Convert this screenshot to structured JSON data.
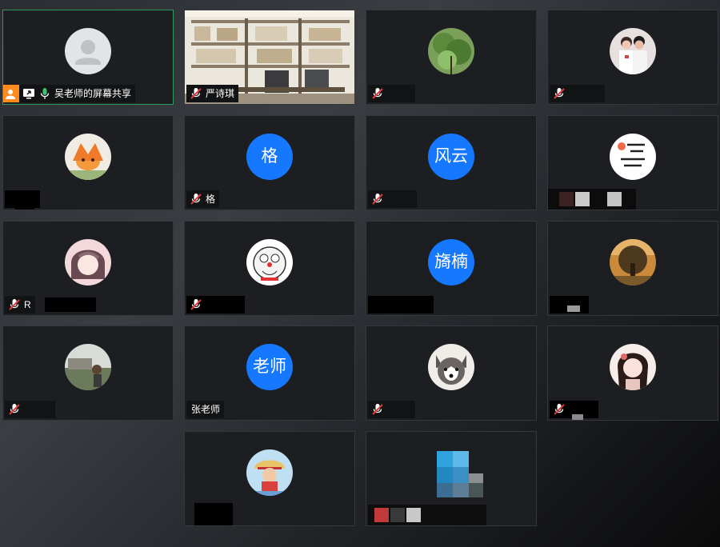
{
  "participants": [
    {
      "id": "p1",
      "name": "吴老师的屏幕共享",
      "avatar_kind": "default",
      "muted": false,
      "sharing": true,
      "active": true
    },
    {
      "id": "p2",
      "name": "严诗琪",
      "avatar_kind": "video",
      "muted": true
    },
    {
      "id": "p3",
      "name": "",
      "avatar_kind": "photo-tree",
      "muted": true
    },
    {
      "id": "p4",
      "name": "",
      "avatar_kind": "photo-couple",
      "muted": true
    },
    {
      "id": "p5",
      "name": "",
      "avatar_kind": "photo-fox",
      "muted": false
    },
    {
      "id": "p6",
      "name": "格",
      "avatar_kind": "text",
      "avatar_text": "格",
      "muted": true
    },
    {
      "id": "p7",
      "name": "",
      "avatar_kind": "text",
      "avatar_text": "风云",
      "muted": true
    },
    {
      "id": "p8",
      "name": "",
      "avatar_kind": "photo-calligraphy",
      "muted": false
    },
    {
      "id": "p9",
      "name": "R",
      "avatar_kind": "photo-anime",
      "muted": true
    },
    {
      "id": "p10",
      "name": "",
      "avatar_kind": "photo-doraemon",
      "muted": true
    },
    {
      "id": "p11",
      "name": "",
      "avatar_kind": "text",
      "avatar_text": "旖楠",
      "muted": false
    },
    {
      "id": "p12",
      "name": "",
      "avatar_kind": "photo-tree-sunset",
      "muted": false
    },
    {
      "id": "p13",
      "name": "",
      "avatar_kind": "photo-scenery",
      "muted": true
    },
    {
      "id": "p14",
      "name": "张老师",
      "avatar_kind": "text",
      "avatar_text": "老师",
      "muted": false
    },
    {
      "id": "p15",
      "name": "",
      "avatar_kind": "photo-husky",
      "muted": true
    },
    {
      "id": "p16",
      "name": "",
      "avatar_kind": "photo-girl",
      "muted": true
    },
    {
      "id": "p17",
      "name": "",
      "avatar_kind": "photo-luffy",
      "muted": false
    },
    {
      "id": "p18",
      "name": "",
      "avatar_kind": "photo-blocks",
      "muted": false
    }
  ],
  "colors": {
    "avatar_blue": "#1677ff",
    "active_border": "#2e9a5e",
    "share_badge": "#ff8a1d",
    "muted_red": "#e03c3c",
    "mic_green": "#3fbf6a"
  },
  "icons": {
    "share": "person-icon",
    "screen": "screen-share-icon",
    "mic": "microphone-icon",
    "muted": "microphone-muted-icon"
  }
}
